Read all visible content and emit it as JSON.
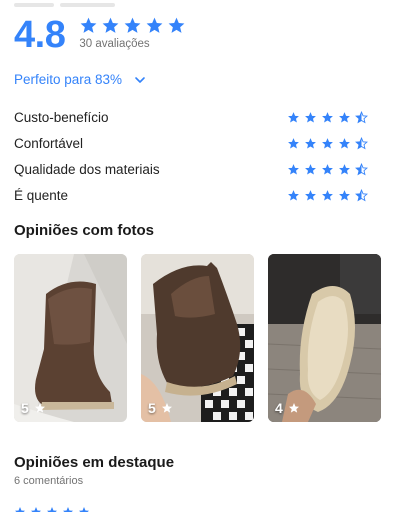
{
  "summary": {
    "score": "4.8",
    "stars": 5,
    "count_label": "30 avaliações",
    "accent_color": "#3483fa"
  },
  "fit": {
    "label": "Perfeito para 83%",
    "icon": "chevron-down-icon"
  },
  "attributes": [
    {
      "label": "Custo-benefício",
      "rating": 4.5
    },
    {
      "label": "Confortável",
      "rating": 4.5
    },
    {
      "label": "Qualidade dos materiais",
      "rating": 4.5
    },
    {
      "label": "É quente",
      "rating": 4.5
    }
  ],
  "photos_section": {
    "title": "Opiniões com fotos",
    "photos": [
      {
        "rating": "5",
        "subject": "brown suede chelsea boot on marble floor"
      },
      {
        "rating": "5",
        "subject": "brown boot held over checkered surface"
      },
      {
        "rating": "4",
        "subject": "boot sole held in a room"
      }
    ]
  },
  "featured": {
    "title": "Opiniões em destaque",
    "count_label": "6 comentários"
  }
}
